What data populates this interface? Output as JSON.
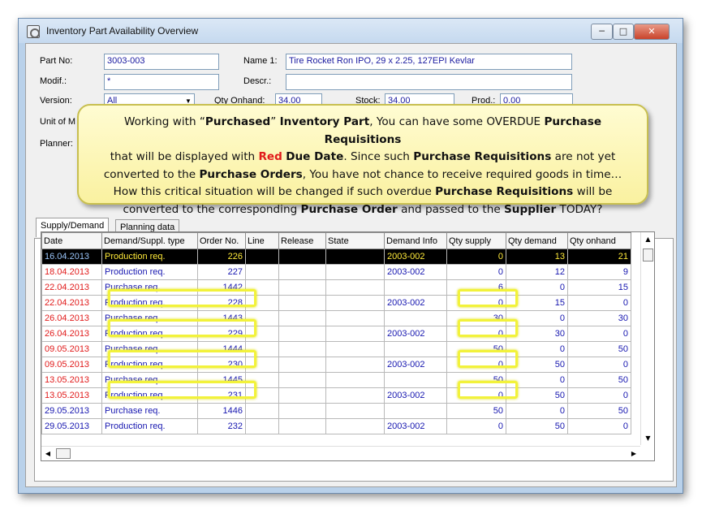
{
  "window": {
    "title": "Inventory Part Availability Overview"
  },
  "form": {
    "part_no_label": "Part No:",
    "part_no_value": "3003-003",
    "name1_label": "Name 1:",
    "name1_value": "Tire Rocket Ron IPO, 29 x 2.25, 127EPI Kevlar",
    "modif_label": "Modif.:",
    "modif_value": "*",
    "descr_label": "Descr.:",
    "descr_value": "",
    "version_label": "Version:",
    "version_value": "All",
    "qty_onhand_label": "Qty Onhand:",
    "qty_onhand_value": "34.00",
    "stock_label": "Stock:",
    "stock_value": "34.00",
    "prod_label": "Prod.:",
    "prod_value": "0.00",
    "uom_label": "Unit of M",
    "planner_label": "Planner:"
  },
  "tabs": [
    "Supply/Demand",
    "Planning data"
  ],
  "callout": {
    "l1_a": "Working with “",
    "l1_b": "Purchased",
    "l1_c": "” ",
    "l1_d": "Inventory Part",
    "l1_e": ", You can have some OVERDUE ",
    "l1_f": "Purchase Requisitions",
    "l2_a": "that will be displayed with ",
    "l2_b": "Red",
    "l2_c": " ",
    "l2_d": "Due Date",
    "l2_e": ".  Since such ",
    "l2_f": "Purchase Requisitions",
    "l2_g": " are not yet",
    "l3_a": "converted to the ",
    "l3_b": "Purchase Orders",
    "l3_c": ", You have not chance to receive required goods in time…",
    "l4_a": "How this critical situation will be changed if such overdue ",
    "l4_b": "Purchase Requisitions",
    "l4_c": " will be",
    "l5_a": "converted to the corresponding ",
    "l5_b": "Purchase Order",
    "l5_c": " and passed to the ",
    "l5_d": "Supplier",
    "l5_e": " TODAY?"
  },
  "grid": {
    "columns": [
      "Date",
      "Demand/Suppl. type",
      "Order No.",
      "Line",
      "Release",
      "State",
      "Demand Info",
      "Qty supply",
      "Qty demand",
      "Qty onhand"
    ],
    "rows": [
      [
        "16.04.2013",
        "Production req.",
        "226",
        "",
        "",
        "",
        "2003-002",
        "0",
        "13",
        "21"
      ],
      [
        "18.04.2013",
        "Production req.",
        "227",
        "",
        "",
        "",
        "2003-002",
        "0",
        "12",
        "9"
      ],
      [
        "22.04.2013",
        "Purchase req.",
        "1442",
        "",
        "",
        "",
        "",
        "6",
        "0",
        "15"
      ],
      [
        "22.04.2013",
        "Production req.",
        "228",
        "",
        "",
        "",
        "2003-002",
        "0",
        "15",
        "0"
      ],
      [
        "26.04.2013",
        "Purchase req.",
        "1443",
        "",
        "",
        "",
        "",
        "30",
        "0",
        "30"
      ],
      [
        "26.04.2013",
        "Production req.",
        "229",
        "",
        "",
        "",
        "2003-002",
        "0",
        "30",
        "0"
      ],
      [
        "09.05.2013",
        "Purchase req.",
        "1444",
        "",
        "",
        "",
        "",
        "50",
        "0",
        "50"
      ],
      [
        "09.05.2013",
        "Production req.",
        "230",
        "",
        "",
        "",
        "2003-002",
        "0",
        "50",
        "0"
      ],
      [
        "13.05.2013",
        "Purchase req.",
        "1445",
        "",
        "",
        "",
        "",
        "50",
        "0",
        "50"
      ],
      [
        "13.05.2013",
        "Production req.",
        "231",
        "",
        "",
        "",
        "2003-002",
        "0",
        "50",
        "0"
      ],
      [
        "29.05.2013",
        "Purchase req.",
        "1446",
        "",
        "",
        "",
        "",
        "50",
        "0",
        "50"
      ],
      [
        "29.05.2013",
        "Production req.",
        "232",
        "",
        "",
        "",
        "2003-002",
        "0",
        "50",
        "0"
      ]
    ]
  },
  "colors": {
    "overdue_date": "#e11b1b",
    "highlight": "#f2f23a",
    "value_text": "#1717b0"
  }
}
